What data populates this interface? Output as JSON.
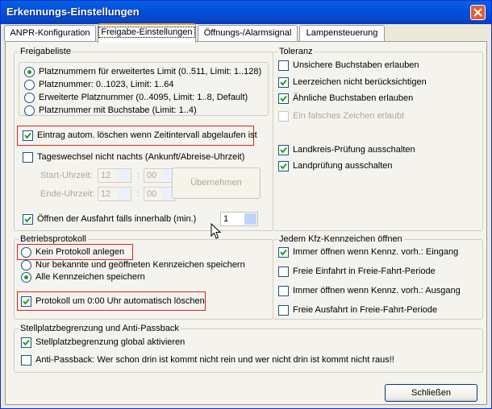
{
  "window": {
    "title": "Erkennungs-Einstellungen"
  },
  "tabs": [
    {
      "label": "ANPR-Konfiguration"
    },
    {
      "label": "Freigabe-Einstellungen"
    },
    {
      "label": "Öffnungs-/Alarmsignal"
    },
    {
      "label": "Lampensteuerung"
    }
  ],
  "freigabeliste": {
    "title": "Freigabeliste",
    "options": [
      {
        "label": "Platznummern für erweitertes Limit (0..511, Limit: 1..128)",
        "selected": true
      },
      {
        "label": "Platznummer: 0..1023, Limit: 1..64",
        "selected": false
      },
      {
        "label": "Erweiterte Platznummer (0..4095, Limit: 1..8, Default)",
        "selected": false
      },
      {
        "label": "Platznummer mit Buchstabe (Limit: 1..4)",
        "selected": false
      }
    ],
    "auto_delete_label": "Eintrag autom. löschen wenn Zeitintervall abgelaufen ist",
    "auto_delete_checked": true,
    "day_change_label": "Tageswechsel nicht nachts (Ankunft/Abreise-Uhrzeit)",
    "day_change_checked": false,
    "start_label": "Start-Uhrzeit:",
    "end_label": "Ende-Uhrzeit:",
    "start_hour": "12",
    "start_minute": "00",
    "end_hour": "12",
    "end_minute": "00",
    "time_separator": ":",
    "apply_label": "Übernehmen",
    "exit_open_label": "Öffnen der Ausfahrt falls innerhalb (min.)",
    "exit_open_checked": true,
    "exit_open_value": "1"
  },
  "toleranz": {
    "title": "Toleranz",
    "items": [
      {
        "label": "Unsichere Buchstaben erlauben",
        "checked": false,
        "enabled": true
      },
      {
        "label": "Leerzeichen nicht berücksichtigen",
        "checked": true,
        "enabled": true
      },
      {
        "label": "Ähnliche Buchstaben erlauben",
        "checked": true,
        "enabled": true
      },
      {
        "label": "Ein falsches Zeichen erlaubt",
        "checked": false,
        "enabled": false
      },
      {
        "label": "Landkreis-Prüfung ausschalten",
        "checked": true,
        "enabled": true
      },
      {
        "label": "Landprüfung ausschalten",
        "checked": true,
        "enabled": true
      }
    ]
  },
  "betriebsprotokoll": {
    "title": "Betriebsprotokoll",
    "options": [
      {
        "label": "Kein Protokoll anlegen",
        "selected": false
      },
      {
        "label": "Nur bekannte und geöffneten Kennzeichen speichern",
        "selected": false
      },
      {
        "label": "Alle Kennzeichen speichern",
        "selected": true
      }
    ],
    "auto_delete_label": "Protokoll um 0:00 Uhr automatisch löschen",
    "auto_delete_checked": true
  },
  "kennzeichen": {
    "title": "Jedem Kfz-Kennzeichen öffnen",
    "items": [
      {
        "label": "Immer öffnen wenn Kennz. vorh.: Eingang",
        "checked": true
      },
      {
        "label": "Freie Einfahrt in Freie-Fahrt-Periode",
        "checked": false
      },
      {
        "label": "Immer öffnen wenn Kennz. vorh.: Ausgang",
        "checked": false
      },
      {
        "label": "Freie Ausfahrt in Freie-Fahrt-Periode",
        "checked": false
      }
    ]
  },
  "stellplatz": {
    "title": "Stellplatzbegrenzung und Anti-Passback",
    "items": [
      {
        "label": "Stellplatzbegrenzung global aktivieren",
        "checked": true
      },
      {
        "label": "Anti-Passback: Wer schon drin ist kommt nicht rein und wer nicht drin ist kommt nicht raus!!",
        "checked": false
      }
    ]
  },
  "close_button": "Schließen",
  "colors": {
    "title_bar": "#0054e3",
    "highlight_box": "#e02020",
    "radio_dot": "#1f9e1f"
  }
}
